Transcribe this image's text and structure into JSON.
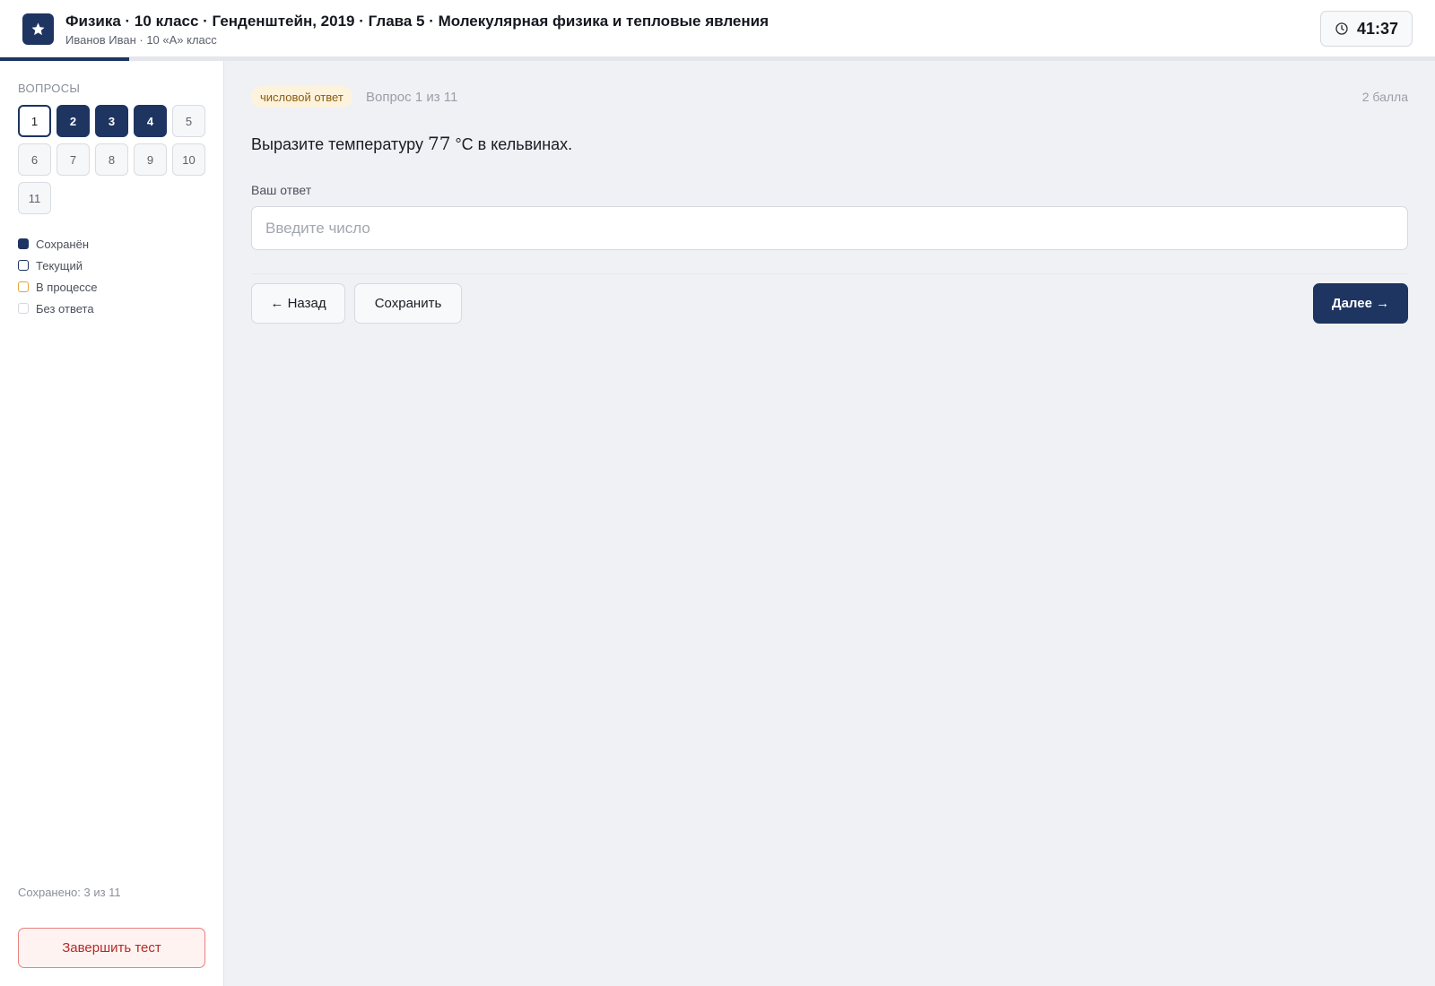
{
  "header": {
    "title": "Физика · 10 класс · Генденштейн, 2019 · Глава 5 · Молекулярная физика и тепловые явления",
    "subtitle": "Иванов Иван · 10 «А» класс",
    "timer": "41:37",
    "logo_icon": "star-icon",
    "progress_fraction": 0.09
  },
  "colors": {
    "accent": "#1e3461",
    "tag_bg": "#fdf3dc",
    "finish_border": "#e8807c",
    "in_progress": "#e0a53a"
  },
  "sidebar": {
    "heading": "ВОПРОСЫ",
    "questions": [
      {
        "label": "1",
        "state": "current"
      },
      {
        "label": "2",
        "state": "saved"
      },
      {
        "label": "3",
        "state": "saved"
      },
      {
        "label": "4",
        "state": "saved"
      },
      {
        "label": "5",
        "state": "none"
      },
      {
        "label": "6",
        "state": "none"
      },
      {
        "label": "7",
        "state": "none"
      },
      {
        "label": "8",
        "state": "none"
      },
      {
        "label": "9",
        "state": "none"
      },
      {
        "label": "10",
        "state": "none"
      },
      {
        "label": "11",
        "state": "none"
      }
    ],
    "legend": {
      "saved": "Сохранён",
      "current": "Текущий",
      "in_progress": "В процессе",
      "no_answer": "Без ответа"
    },
    "saved_count": "Сохранено: 3 из 11",
    "finish_label": "Завершить тест"
  },
  "question": {
    "type_tag": "числовой ответ",
    "number_text": "Вопрос 1 из 11",
    "points": "2 балла",
    "text_before": "Выразите температуру ",
    "math_value": "77",
    "unit": " °C",
    "text_after": " в кельвинах.",
    "answer_label": "Ваш ответ",
    "answer_value": "",
    "answer_placeholder": "Введите число"
  },
  "nav": {
    "back_label": "← Назад",
    "save_label": "Сохранить",
    "next_label": "Далее →"
  }
}
